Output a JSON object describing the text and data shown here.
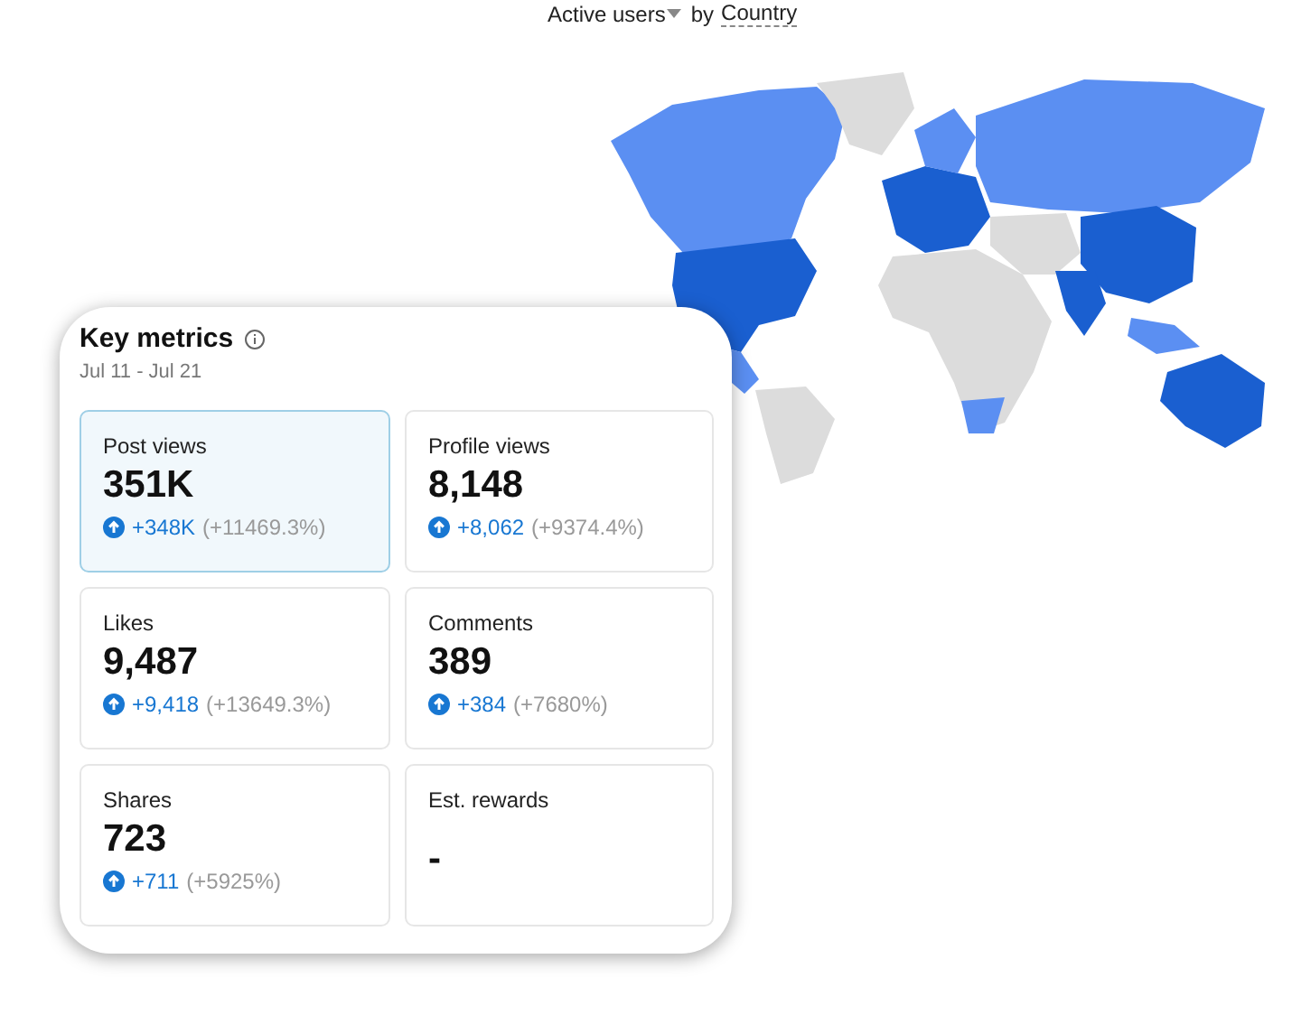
{
  "map_header": {
    "metric": "Active users",
    "by": "by",
    "dimension": "Country"
  },
  "key_metrics": {
    "title": "Key metrics",
    "date_range": "Jul 11 - Jul 21",
    "metrics": [
      {
        "label": "Post views",
        "value": "351K",
        "selected": true,
        "change": "+348K",
        "percent": "(+11469.3%)"
      },
      {
        "label": "Profile views",
        "value": "8,148",
        "selected": false,
        "change": "+8,062",
        "percent": "(+9374.4%)"
      },
      {
        "label": "Likes",
        "value": "9,487",
        "selected": false,
        "change": "+9,418",
        "percent": "(+13649.3%)"
      },
      {
        "label": "Comments",
        "value": "389",
        "selected": false,
        "change": "+384",
        "percent": "(+7680%)"
      },
      {
        "label": "Shares",
        "value": "723",
        "selected": false,
        "change": "+711",
        "percent": "(+5925%)"
      },
      {
        "label": "Est. rewards",
        "value": "-",
        "selected": false
      }
    ]
  }
}
